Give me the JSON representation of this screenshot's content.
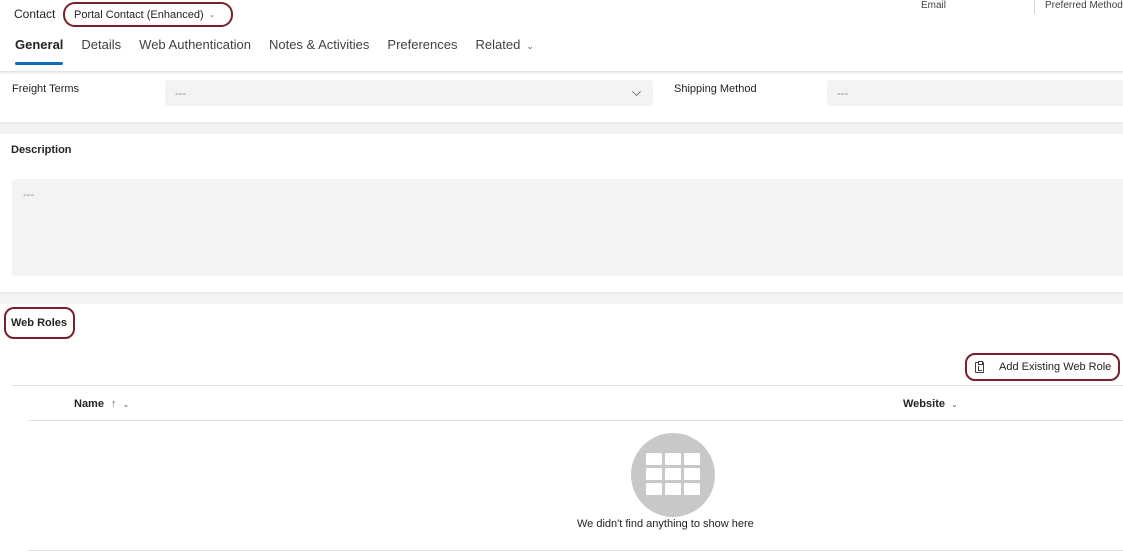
{
  "header": {
    "entity_label": "Contact",
    "form_selector": "Portal Contact (Enhanced)",
    "fields": {
      "email": "Email",
      "preferred_method": "Preferred Method"
    }
  },
  "tabs": [
    {
      "label": "General",
      "active": true
    },
    {
      "label": "Details"
    },
    {
      "label": "Web Authentication"
    },
    {
      "label": "Notes & Activities"
    },
    {
      "label": "Preferences"
    },
    {
      "label": "Related"
    }
  ],
  "shipping": {
    "freight_terms_label": "Freight Terms",
    "freight_terms_value": "---",
    "shipping_method_label": "Shipping Method",
    "shipping_method_value": "---"
  },
  "description": {
    "title": "Description",
    "value": "---"
  },
  "web_roles": {
    "title": "Web Roles",
    "add_button": "Add Existing Web Role",
    "columns": {
      "name": "Name",
      "website": "Website"
    },
    "sort_indicator": "↑",
    "empty_message": "We didn't find anything to show here"
  },
  "colors": {
    "accent": "#0f6cbd",
    "highlight_border": "#7a1f2b",
    "field_bg": "#f3f3f3"
  }
}
